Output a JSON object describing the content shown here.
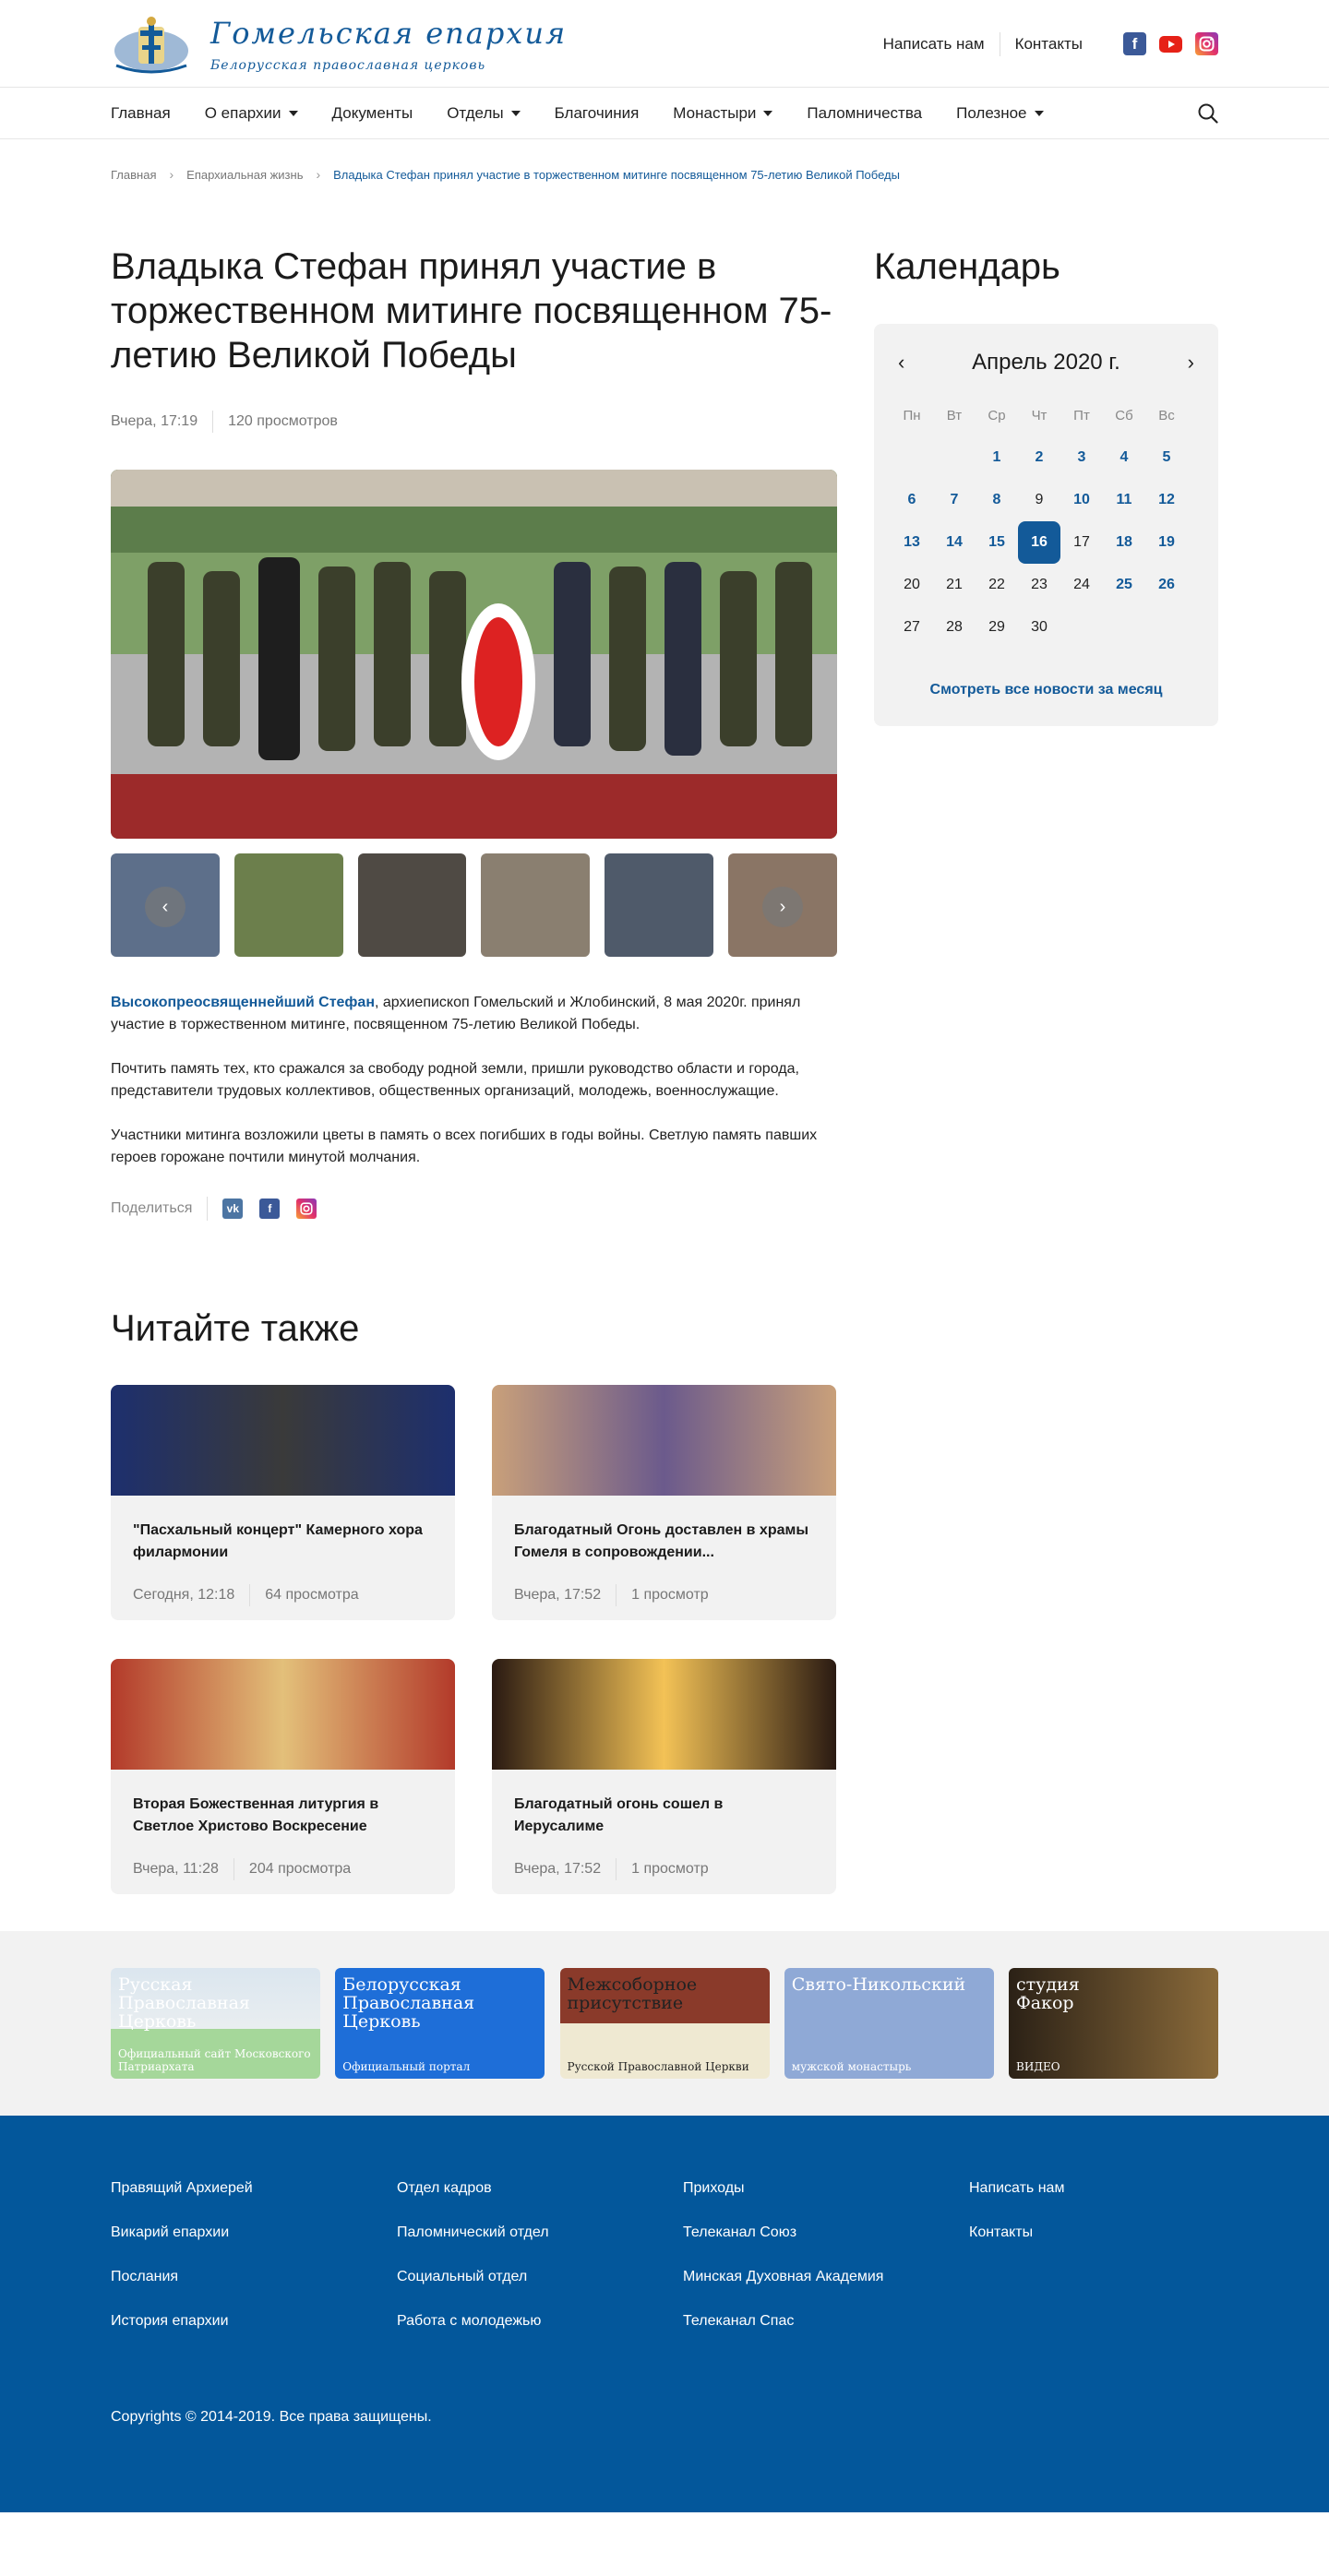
{
  "colors": {
    "brand": "#135a99",
    "footer_bg": "#03579b",
    "card_bg": "#f2f2f2"
  },
  "header": {
    "logo_title": "Гомельская епархия",
    "logo_subtitle": "Белорусская православная церковь",
    "links": [
      "Написать нам",
      "Контакты"
    ],
    "socials": [
      "facebook-icon",
      "youtube-icon",
      "instagram-icon"
    ]
  },
  "nav": {
    "items": [
      {
        "label": "Главная",
        "dropdown": false
      },
      {
        "label": "О епархии",
        "dropdown": true
      },
      {
        "label": "Документы",
        "dropdown": false
      },
      {
        "label": "Отделы",
        "dropdown": true
      },
      {
        "label": "Благочиния",
        "dropdown": false
      },
      {
        "label": "Монастыри",
        "dropdown": true
      },
      {
        "label": "Паломничества",
        "dropdown": false
      },
      {
        "label": "Полезное",
        "dropdown": true
      }
    ]
  },
  "breadcrumb": [
    "Главная",
    "Епархиальная жизнь",
    "Владыка Стефан принял участие в торжественном митинге посвященном 75-летию Великой Победы"
  ],
  "article": {
    "title": "Владыка Стефан принял участие в торжественном митинге посвященном 75-летию Великой Победы",
    "date": "Вчера, 17:19",
    "views": "120 просмотров",
    "p1_highlight": "Высокопреосвященнейший Стефан",
    "p1_rest": ", архиепископ Гомельский и Жлобинский, 8 мая 2020г. принял участие в торжественном митинге, посвященном 75-летию Великой Победы.",
    "p2": "Почтить память тех, кто сражался за свободу родной земли, пришли руководство области и города, представители трудовых коллективов, общественных организаций, молодежь, военнослужащие.",
    "p3": "Участники митинга возложили цветы в память о всех погибших в годы войны. Светлую память павших героев горожане почтили минутой молчания.",
    "share_label": "Поделиться"
  },
  "calendar": {
    "heading": "Календарь",
    "month": "Апрель 2020 г.",
    "weekdays": [
      "Пн",
      "Вт",
      "Ср",
      "Чт",
      "Пт",
      "Сб",
      "Вс"
    ],
    "leading_blanks": 2,
    "days": [
      {
        "d": "1",
        "news": true
      },
      {
        "d": "2",
        "news": true
      },
      {
        "d": "3",
        "news": true
      },
      {
        "d": "4",
        "news": true
      },
      {
        "d": "5",
        "news": true
      },
      {
        "d": "6",
        "news": true
      },
      {
        "d": "7",
        "news": true
      },
      {
        "d": "8",
        "news": true
      },
      {
        "d": "9",
        "news": false
      },
      {
        "d": "10",
        "news": true
      },
      {
        "d": "11",
        "news": true
      },
      {
        "d": "12",
        "news": true
      },
      {
        "d": "13",
        "news": true
      },
      {
        "d": "14",
        "news": true
      },
      {
        "d": "15",
        "news": true
      },
      {
        "d": "16",
        "news": true,
        "selected": true
      },
      {
        "d": "17",
        "news": false
      },
      {
        "d": "18",
        "news": true
      },
      {
        "d": "19",
        "news": true
      },
      {
        "d": "20",
        "news": false
      },
      {
        "d": "21",
        "news": false
      },
      {
        "d": "22",
        "news": false
      },
      {
        "d": "23",
        "news": false
      },
      {
        "d": "24",
        "news": false
      },
      {
        "d": "25",
        "news": true
      },
      {
        "d": "26",
        "news": true
      },
      {
        "d": "27",
        "news": false
      },
      {
        "d": "28",
        "news": false
      },
      {
        "d": "29",
        "news": false
      },
      {
        "d": "30",
        "news": false
      }
    ],
    "link": "Смотреть все новости за месяц"
  },
  "also": {
    "heading": "Читайте также",
    "cards": [
      {
        "title": "\"Пасхальный концерт\" Камерного хора филармонии",
        "date": "Сегодня, 12:18",
        "views": "64 просмотра"
      },
      {
        "title": "Благодатный Огонь доставлен в храмы Гомеля в сопровождении...",
        "date": "Вчера, 17:52",
        "views": "1 просмотр"
      },
      {
        "title": "Вторая Божественная литургия в Светлое Христово Воскресение",
        "date": "Вчера, 11:28",
        "views": "204 просмотра"
      },
      {
        "title": "Благодатный огонь сошел в Иерусалиме",
        "date": "Вчера, 17:52",
        "views": "1 просмотр"
      }
    ]
  },
  "banners": [
    {
      "lines": [
        "Русская",
        "Православная",
        "Церковь"
      ],
      "sub": "Официальный сайт Московского Патриархата"
    },
    {
      "lines": [
        "Белорусская",
        "Православная",
        "Церковь"
      ],
      "sub": "Официальный портал"
    },
    {
      "lines": [
        "Межсоборное",
        "присутствие"
      ],
      "sub": "Русской Православной Церкви"
    },
    {
      "lines": [
        "Свято-Никольский"
      ],
      "sub": "мужской монастырь"
    },
    {
      "lines": [
        "студия",
        "Факор"
      ],
      "sub": "ВИДЕО"
    }
  ],
  "footer": {
    "columns": [
      [
        "Правящий Архиерей",
        "Викарий епархии",
        "Послания",
        "История епархии"
      ],
      [
        "Отдел кадров",
        "Паломнический отдел",
        "Социальный отдел",
        "Работа с молодежью"
      ],
      [
        "Приходы",
        "Телеканал Союз",
        "Минская Духовная Академия",
        "Телеканал Спас"
      ],
      [
        "Написать нам",
        "Контакты"
      ]
    ],
    "copyright": "Copyrights © 2014-2019. Все права защищены."
  }
}
